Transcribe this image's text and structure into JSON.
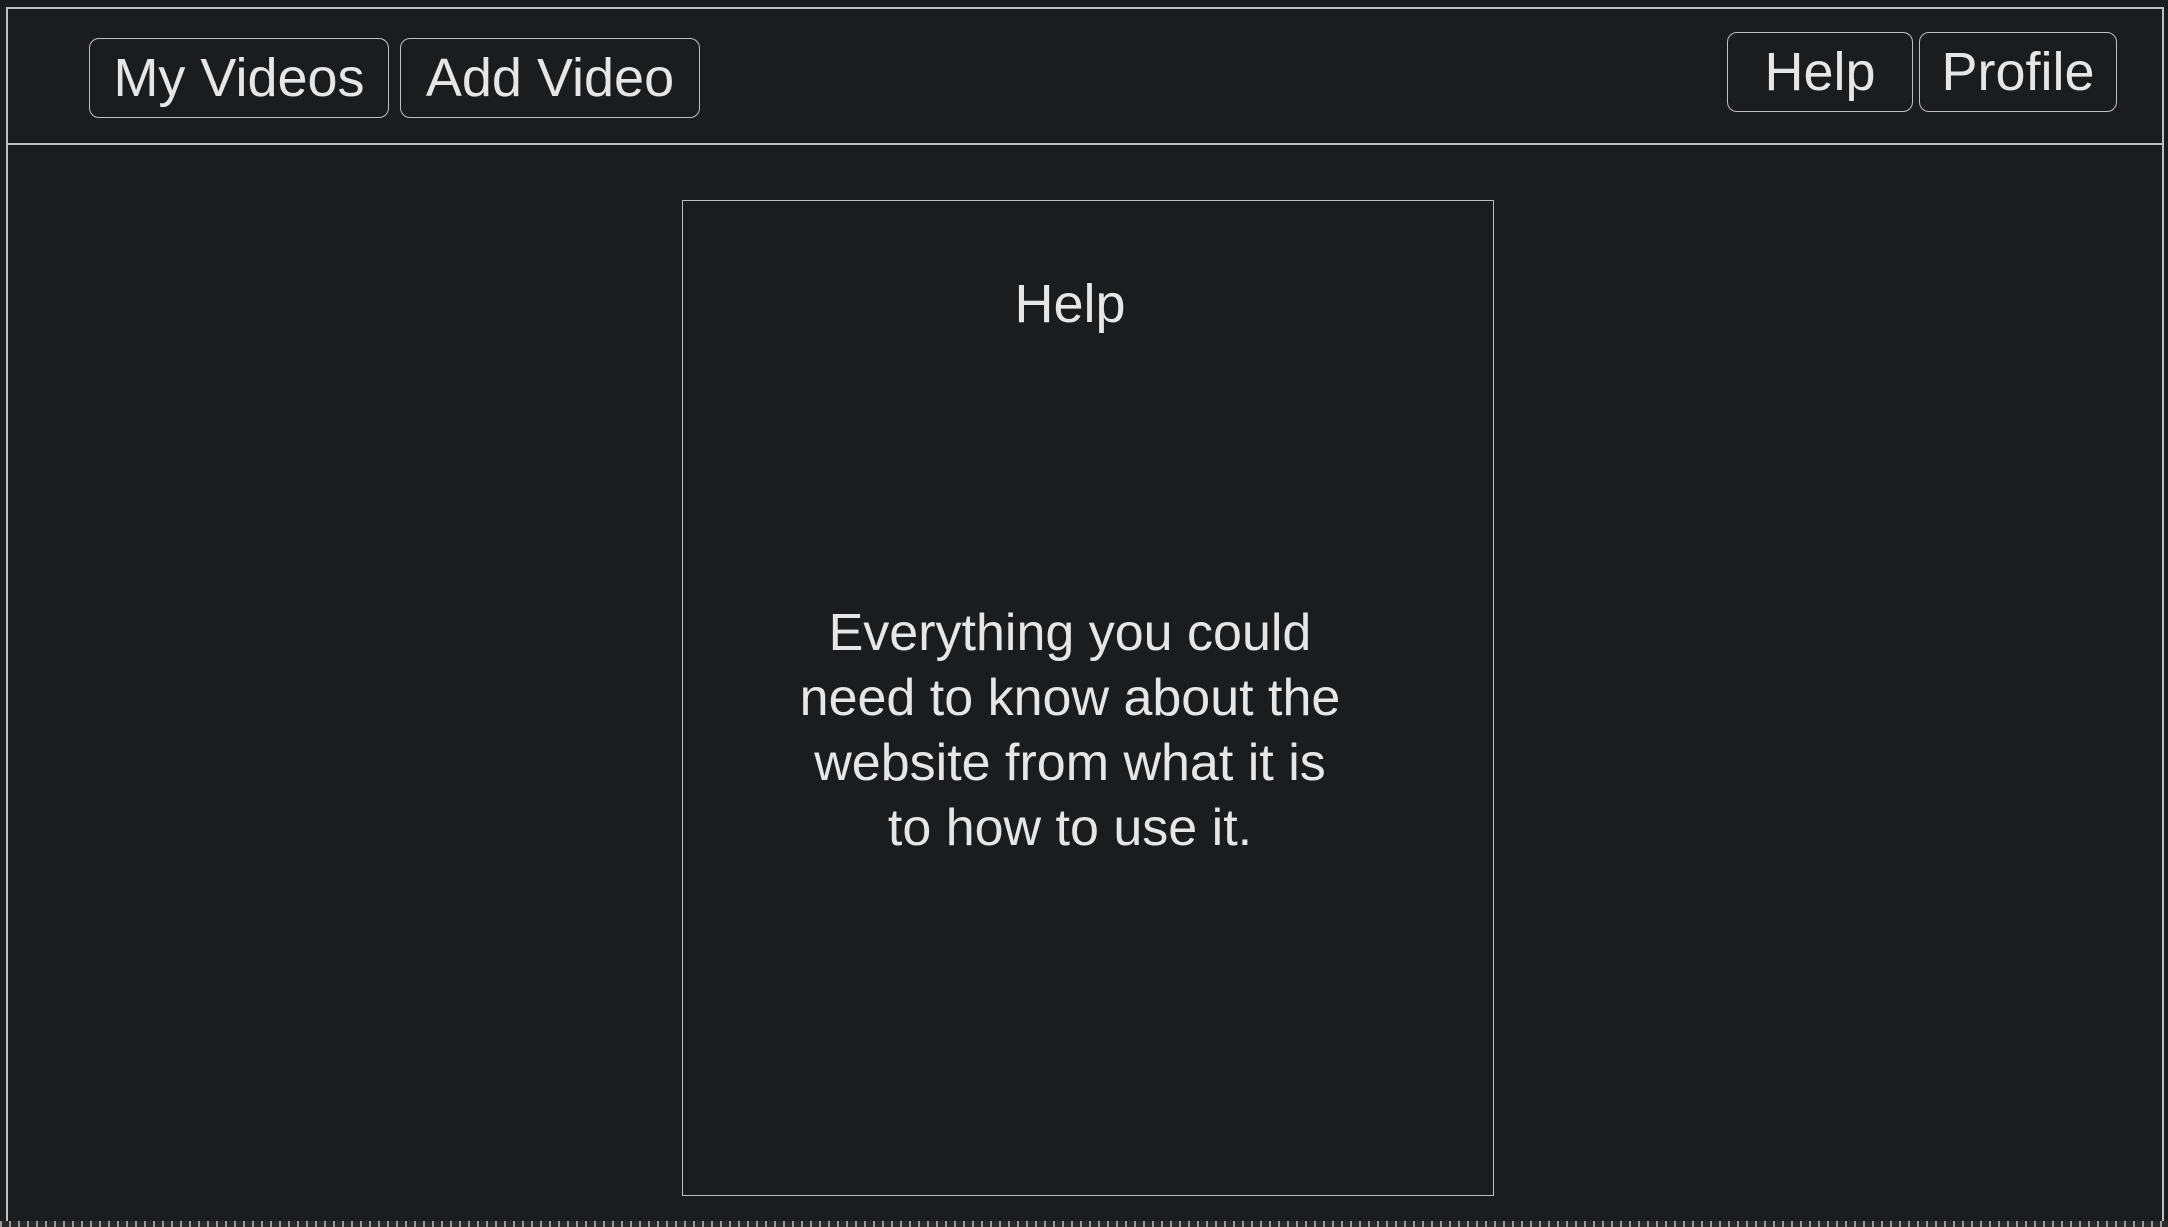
{
  "nav": {
    "my_videos_label": "My Videos",
    "add_video_label": "Add Video",
    "help_label": "Help",
    "profile_label": "Profile"
  },
  "help_panel": {
    "title": "Help",
    "body": "Everything you could need to know about the website from what it is to how to use it."
  },
  "colors": {
    "background": "#1b1c1e",
    "border": "#bfbfbf",
    "text": "#e6e6e6"
  }
}
